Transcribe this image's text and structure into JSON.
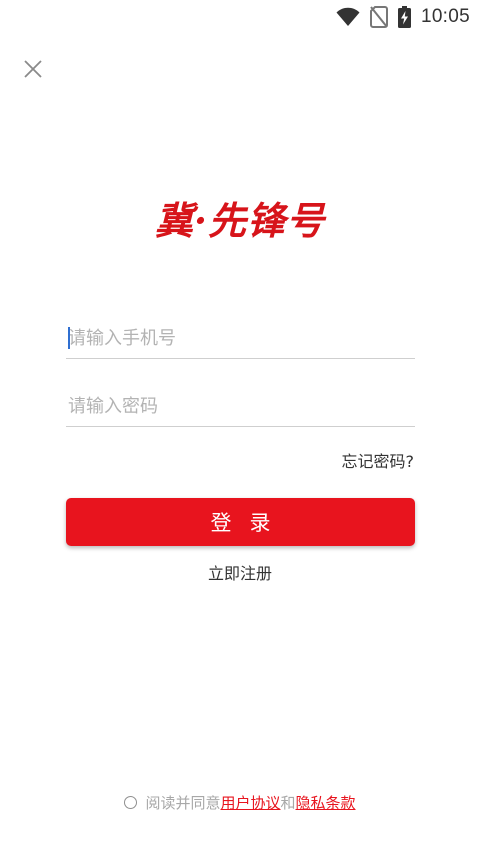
{
  "status_bar": {
    "time": "10:05",
    "icons": [
      "wifi-icon",
      "no-sim-icon",
      "battery-charging-icon"
    ]
  },
  "header": {
    "close_icon": "close-icon"
  },
  "logo": {
    "text": "冀·先锋号",
    "color": "#d7141a"
  },
  "form": {
    "phone_placeholder": "请输入手机号",
    "phone_value": "",
    "password_placeholder": "请输入密码",
    "password_value": "",
    "forgot_label": "忘记密码?",
    "login_label": "登录",
    "register_label": "立即注册"
  },
  "agreement": {
    "prefix": "阅读并同意",
    "user_agreement": "用户协议",
    "conjunction": "和",
    "privacy": "隐私条款"
  },
  "colors": {
    "accent": "#e8141e",
    "divider": "#cfcfcf",
    "placeholder": "#b3b3b3"
  }
}
